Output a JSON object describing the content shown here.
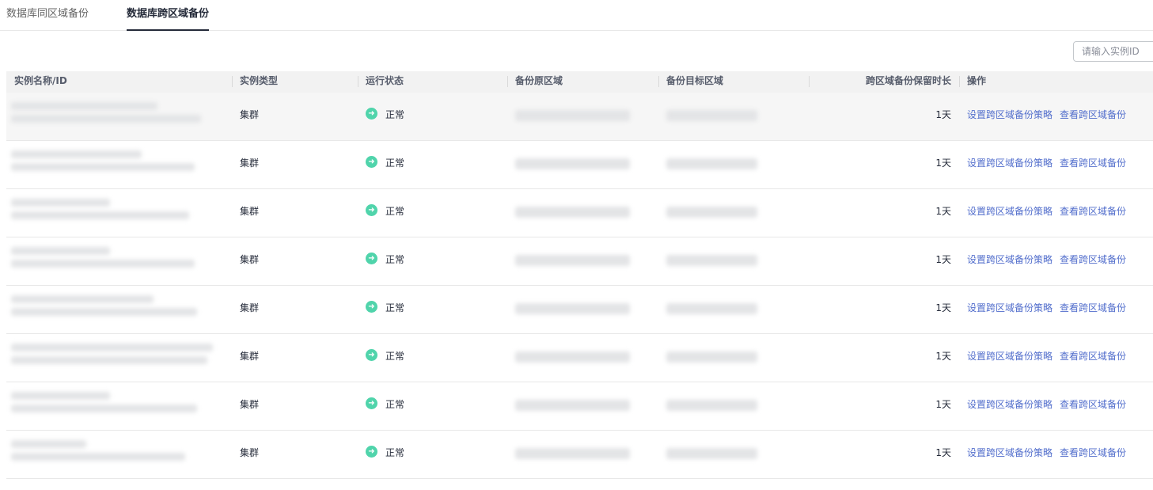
{
  "tabs": [
    {
      "label": "数据库同区域备份",
      "active": false
    },
    {
      "label": "数据库跨区域备份",
      "active": true
    }
  ],
  "search": {
    "placeholder": "请输入实例ID",
    "value": ""
  },
  "table": {
    "columns": {
      "name": "实例名称/ID",
      "type": "实例类型",
      "status": "运行状态",
      "source_region": "备份原区域",
      "target_region": "备份目标区域",
      "retention": "跨区域备份保留时长",
      "actions": "操作"
    },
    "rows": [
      {
        "type": "集群",
        "status": "正常",
        "retention": "1天",
        "action_set": "设置跨区域备份策略",
        "action_view": "查看跨区域备份"
      },
      {
        "type": "集群",
        "status": "正常",
        "retention": "1天",
        "action_set": "设置跨区域备份策略",
        "action_view": "查看跨区域备份"
      },
      {
        "type": "集群",
        "status": "正常",
        "retention": "1天",
        "action_set": "设置跨区域备份策略",
        "action_view": "查看跨区域备份"
      },
      {
        "type": "集群",
        "status": "正常",
        "retention": "1天",
        "action_set": "设置跨区域备份策略",
        "action_view": "查看跨区域备份"
      },
      {
        "type": "集群",
        "status": "正常",
        "retention": "1天",
        "action_set": "设置跨区域备份策略",
        "action_view": "查看跨区域备份"
      },
      {
        "type": "集群",
        "status": "正常",
        "retention": "1天",
        "action_set": "设置跨区域备份策略",
        "action_view": "查看跨区域备份"
      },
      {
        "type": "集群",
        "status": "正常",
        "retention": "1天",
        "action_set": "设置跨区域备份策略",
        "action_view": "查看跨区域备份"
      },
      {
        "type": "集群",
        "status": "正常",
        "retention": "1天",
        "action_set": "设置跨区域备份策略",
        "action_view": "查看跨区域备份"
      }
    ]
  },
  "icons": {
    "status": "arrow-right-circle-icon"
  },
  "colors": {
    "status_ok": "#50d4ab",
    "link": "#526ecc"
  }
}
